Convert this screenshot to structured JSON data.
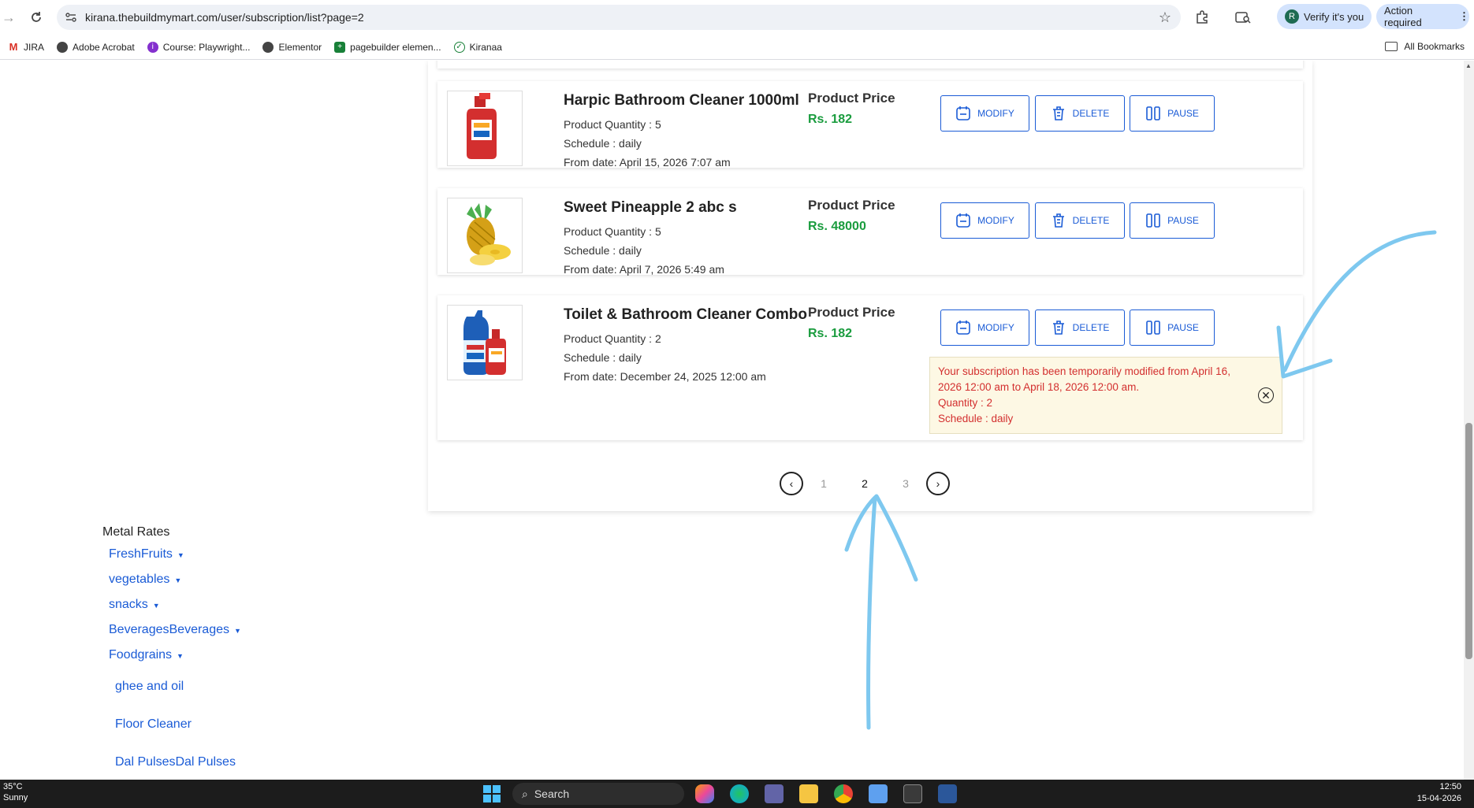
{
  "browser": {
    "url": "kirana.thebuildmymart.com/user/subscription/list?page=2",
    "verify_label": "Verify it's you",
    "avatar_letter": "R",
    "action_label": "Action required",
    "bookmarks": [
      "JIRA",
      "Adobe Acrobat",
      "Course: Playwright...",
      "Elementor",
      "pagebuilder elemen...",
      "Kiranaa"
    ],
    "all_bookmarks": "All Bookmarks"
  },
  "subscriptions": [
    {
      "name": "Harpic Bathroom Cleaner 1000ml",
      "quantity": "Product Quantity : 5",
      "schedule": "Schedule : daily",
      "from_date": "From date: April 15, 2026 7:07 am",
      "price_label": "Product Price",
      "price": "Rs. 182"
    },
    {
      "name": "Sweet Pineapple 2 abc s",
      "quantity": "Product Quantity : 5",
      "schedule": "Schedule : daily",
      "from_date": "From date: April 7, 2026 5:49 am",
      "price_label": "Product Price",
      "price": "Rs. 48000"
    },
    {
      "name": "Toilet & Bathroom Cleaner Combo",
      "quantity": "Product Quantity : 2",
      "schedule": "Schedule : daily",
      "from_date": "From date: December 24, 2025 12:00 am",
      "price_label": "Product Price",
      "price": "Rs. 182",
      "notice": {
        "line1": "Your subscription has been temporarily modified from April 16,",
        "line2": "2026 12:00 am to April 18, 2026 12:00 am.",
        "line3": "Quantity : 2",
        "line4": "Schedule : daily"
      }
    }
  ],
  "buttons": {
    "modify": "MODIFY",
    "delete": "DELETE",
    "pause": "PAUSE"
  },
  "pagination": {
    "pages": [
      "1",
      "2",
      "3"
    ],
    "current": "2"
  },
  "sidebar": {
    "heading": "Metal Rates",
    "categories": [
      "FreshFruits",
      "vegetables",
      "snacks",
      "BeveragesBeverages",
      "Foodgrains"
    ],
    "subitems": [
      "ghee and oil",
      "Floor Cleaner",
      "Dal PulsesDal Pulses"
    ]
  },
  "taskbar": {
    "temp": "35°C",
    "weather": "Sunny",
    "search": "Search",
    "time": "12:50",
    "date": "15-04-2026"
  },
  "colors": {
    "accent_blue": "#1a5bd6",
    "price_green": "#1a9c3e",
    "notice_red": "#d32f2f",
    "notice_bg": "#fdf8e4",
    "annotation": "#7ec8ef"
  }
}
